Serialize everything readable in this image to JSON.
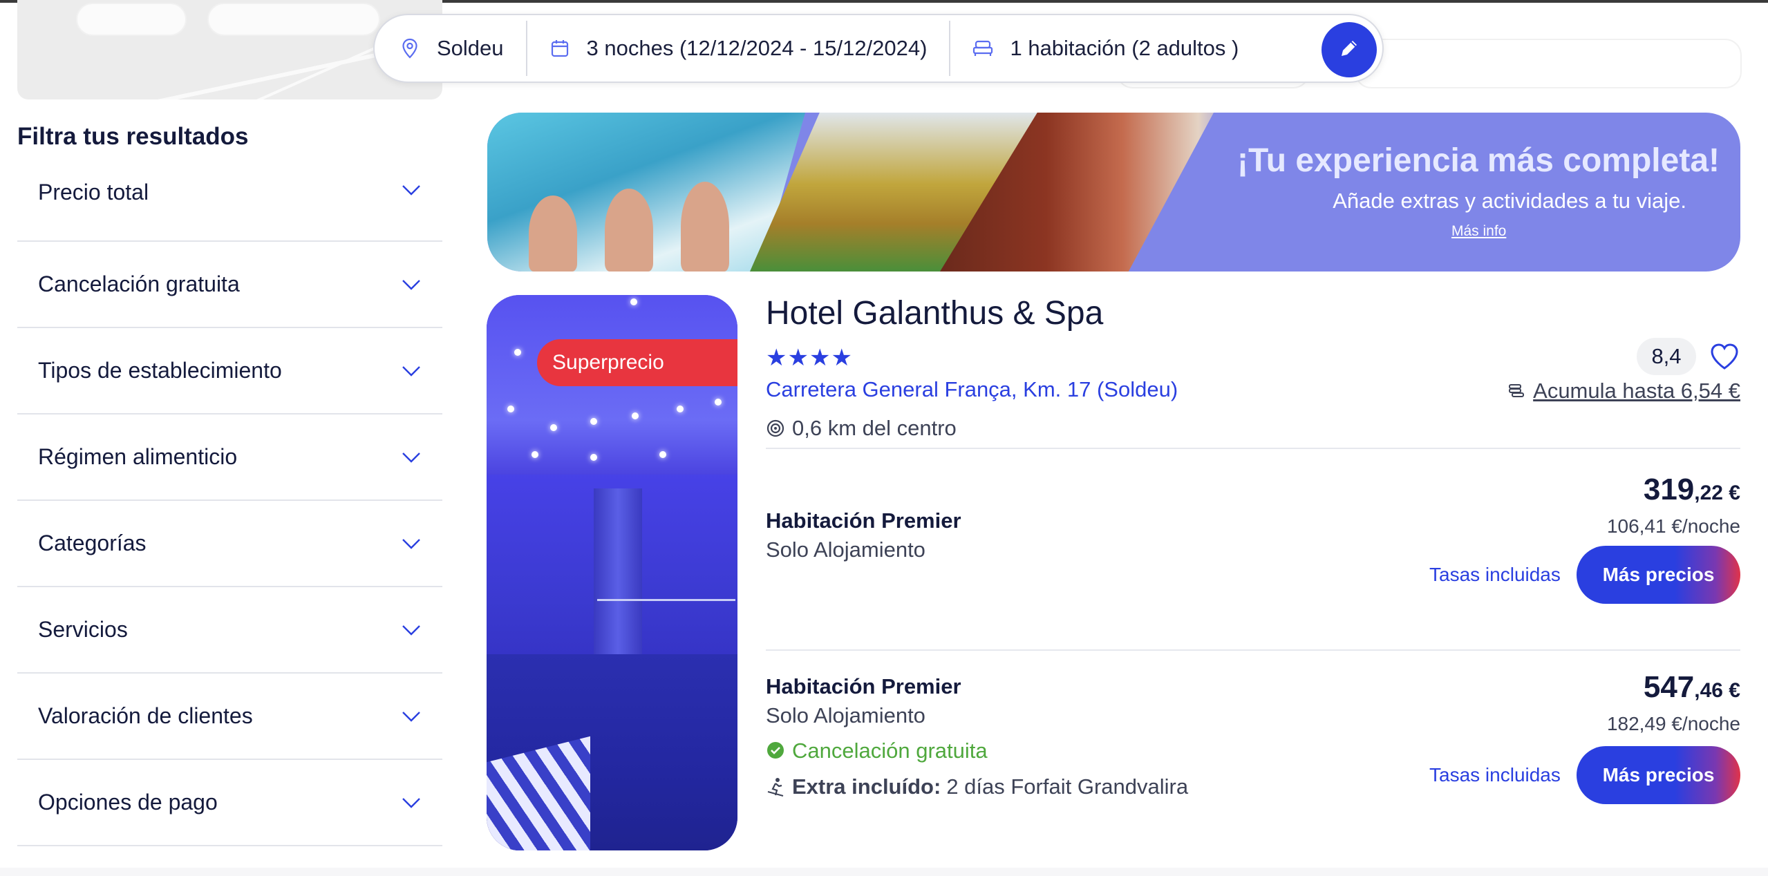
{
  "search": {
    "destination": "Soldeu",
    "dates": "3 noches (12/12/2024 - 15/12/2024)",
    "rooms": "1 habitación (2 adultos )"
  },
  "filters": {
    "title": "Filtra tus resultados",
    "items": [
      {
        "label": "Precio total"
      },
      {
        "label": "Cancelación gratuita"
      },
      {
        "label": "Tipos de establecimiento"
      },
      {
        "label": "Régimen alimenticio"
      },
      {
        "label": "Categorías"
      },
      {
        "label": "Servicios"
      },
      {
        "label": "Valoración de clientes"
      },
      {
        "label": "Opciones de pago"
      }
    ]
  },
  "banner": {
    "title": "¡Tu experiencia más completa!",
    "subtitle": "Añade extras y actividades a tu viaje.",
    "link": "Más info"
  },
  "hotel": {
    "badge": "Superprecio",
    "name": "Hotel Galanthus & Spa",
    "stars": 4,
    "stars_text": "★★★★",
    "address": "Carretera General França, Km. 17 (Soldeu)",
    "distance": "0,6 km del centro",
    "rating": "8,4",
    "accumulate": "Acumula hasta 6,54 €",
    "rooms": [
      {
        "name": "Habitación Premier",
        "board": "Solo Alojamiento",
        "price_int": "319",
        "price_dec": ",22 €",
        "per_night": "106,41 €/noche",
        "taxes": "Tasas incluidas",
        "button": "Más precios"
      },
      {
        "name": "Habitación Premier",
        "board": "Solo Alojamiento",
        "cancellation": "Cancelación gratuita",
        "extra_label": "Extra incluído:",
        "extra_value": "2 días Forfait Grandvalira",
        "price_int": "547",
        "price_dec": ",46 €",
        "per_night": "182,49 €/noche",
        "taxes": "Tasas incluidas",
        "button": "Más precios"
      }
    ]
  },
  "colors": {
    "primary": "#2a3fe0",
    "badge": "#e8353f",
    "success": "#4fa83d",
    "text": "#141a3c"
  }
}
